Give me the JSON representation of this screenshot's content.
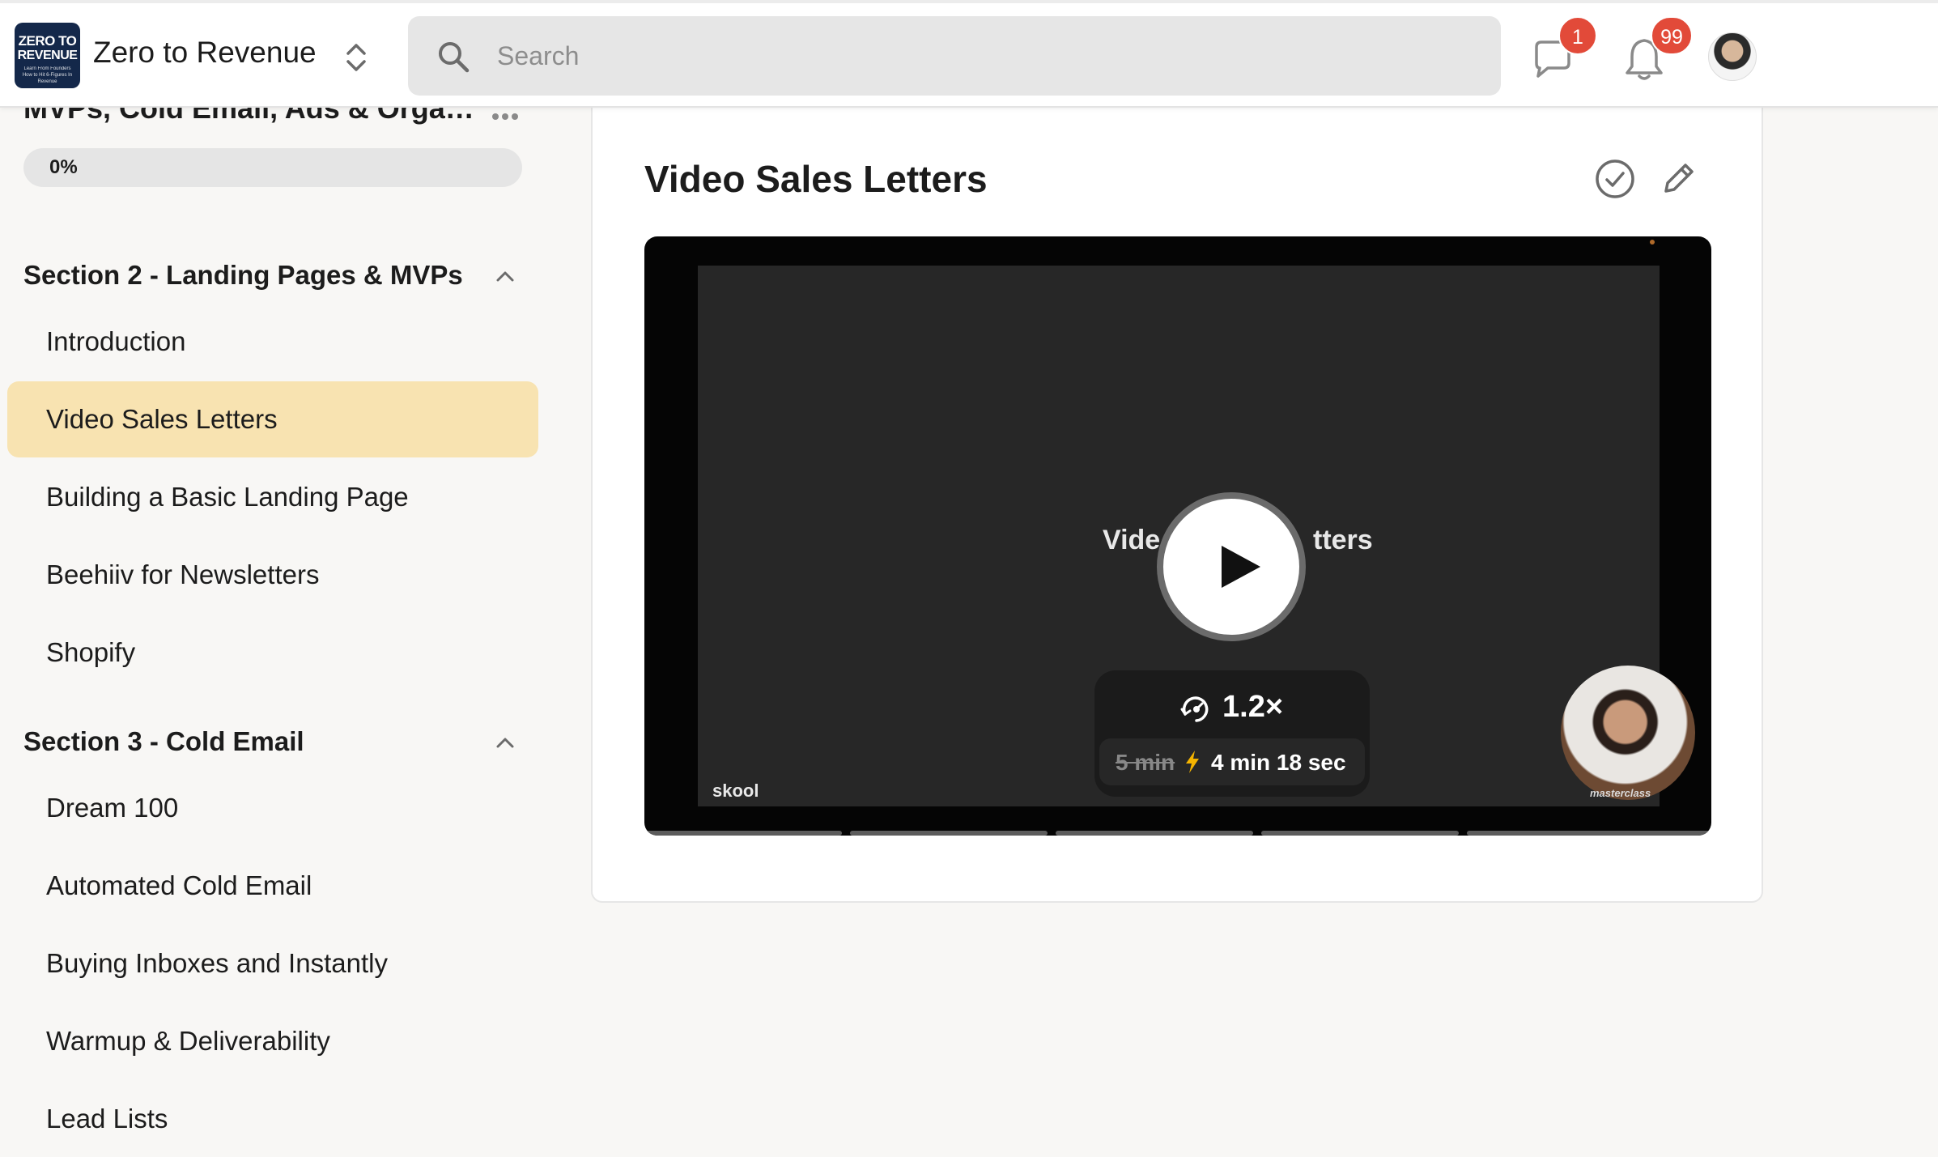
{
  "header": {
    "logo_line1": "ZERO TO",
    "logo_line2": "REVENUE",
    "logo_line3": "Learn From Founders How to Hit 6-Figures In Revenue",
    "group_name": "Zero to Revenue",
    "search_placeholder": "Search",
    "chat_badge": "1",
    "notification_badge": "99"
  },
  "sidebar": {
    "course_title": "MVPs, Cold Email, Ads & Organi...",
    "progress_label": "0%",
    "progress_value": 0,
    "sections": [
      {
        "title": "Section 2 - Landing Pages & MVPs",
        "lessons": [
          {
            "label": "Introduction",
            "active": false
          },
          {
            "label": "Video Sales Letters",
            "active": true
          },
          {
            "label": "Building a Basic Landing Page",
            "active": false
          },
          {
            "label": "Beehiiv for Newsletters",
            "active": false
          },
          {
            "label": "Shopify",
            "active": false
          }
        ]
      },
      {
        "title": "Section 3 - Cold Email",
        "lessons": [
          {
            "label": "Dream 100",
            "active": false
          },
          {
            "label": "Automated Cold Email",
            "active": false
          },
          {
            "label": "Buying Inboxes and Instantly",
            "active": false
          },
          {
            "label": "Warmup & Deliverability",
            "active": false
          },
          {
            "label": "Lead Lists",
            "active": false
          }
        ]
      }
    ]
  },
  "main": {
    "lesson_title": "Video Sales Letters",
    "video": {
      "slide_title_left": "Vide",
      "slide_title_right": "tters",
      "speed": "1.2×",
      "original_duration": "5 min",
      "new_duration": "4 min 18 sec",
      "watermark_left": "skool",
      "watermark_right": "masterclass"
    }
  },
  "colors": {
    "accent_active": "#f8e3b1",
    "badge": "#e24a39",
    "progress_fill": "#f5cc4e"
  },
  "icons": [
    "switch-group-icon",
    "search-icon",
    "chat-icon",
    "bell-icon",
    "more-icon",
    "chevron-up-icon",
    "check-circle-icon",
    "pencil-icon",
    "play-icon",
    "speed-icon",
    "bolt-icon"
  ]
}
